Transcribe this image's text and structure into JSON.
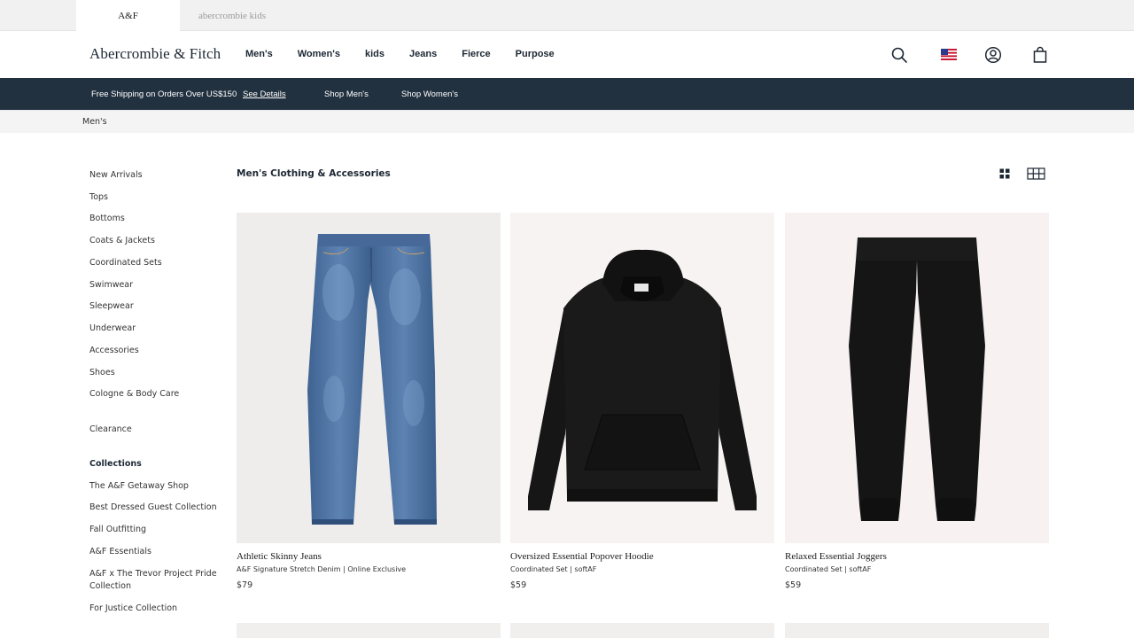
{
  "brand_tabs": [
    {
      "label": "A&F"
    },
    {
      "label": "abercrombie kids"
    }
  ],
  "header": {
    "logo": "Abercrombie & Fitch",
    "nav": [
      {
        "label": "Men's"
      },
      {
        "label": "Women's"
      },
      {
        "label": "kids"
      },
      {
        "label": "Jeans"
      },
      {
        "label": "Fierce"
      },
      {
        "label": "Purpose"
      }
    ],
    "icons": [
      "search-icon",
      "us-flag-icon",
      "account-icon",
      "shopping-bag-icon"
    ]
  },
  "promo": {
    "shipping": "Free Shipping on Orders Over US$150",
    "see_details": "See Details",
    "shop_mens": "Shop Men's",
    "shop_womens": "Shop Women's"
  },
  "breadcrumb": "Men's",
  "sidebar": {
    "categories": [
      {
        "label": "New Arrivals"
      },
      {
        "label": "Tops"
      },
      {
        "label": "Bottoms"
      },
      {
        "label": "Coats & Jackets"
      },
      {
        "label": "Coordinated Sets"
      },
      {
        "label": "Swimwear"
      },
      {
        "label": "Sleepwear"
      },
      {
        "label": "Underwear"
      },
      {
        "label": "Accessories"
      },
      {
        "label": "Shoes"
      },
      {
        "label": "Cologne & Body Care"
      }
    ],
    "clearance": "Clearance",
    "collections_heading": "Collections",
    "collections": [
      {
        "label": "The A&F Getaway Shop"
      },
      {
        "label": "Best Dressed Guest Collection"
      },
      {
        "label": "Fall Outfitting"
      },
      {
        "label": "A&F Essentials"
      },
      {
        "label": "A&F x The Trevor Project Pride",
        "label2": "Collection"
      },
      {
        "label": "For Justice Collection"
      }
    ]
  },
  "main": {
    "title": "Men's Clothing & Accessories",
    "products": [
      {
        "name": "Athletic Skinny Jeans",
        "subtitle": "A&F Signature Stretch Denim | Online Exclusive",
        "price": "$79"
      },
      {
        "name": "Oversized Essential Popover Hoodie",
        "subtitle": "Coordinated Set | softAF",
        "price": "$59"
      },
      {
        "name": "Relaxed Essential Joggers",
        "subtitle": "Coordinated Set | softAF",
        "price": "$59"
      }
    ]
  },
  "colors": {
    "navy": "#223140",
    "denim": "#4a6f9e",
    "black": "#151515"
  }
}
